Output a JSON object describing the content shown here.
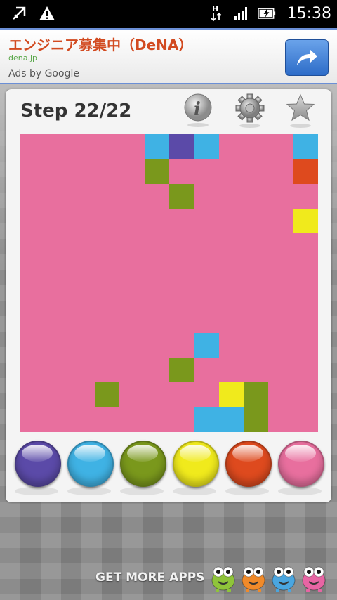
{
  "status_bar": {
    "time": "15:38",
    "icons": [
      "usb-debug-icon",
      "warning-icon",
      "data-transfer-icon",
      "signal-icon",
      "battery-charging-icon"
    ]
  },
  "ad": {
    "title": "エンジニア募集中（DeNA）",
    "url": "dena.jp",
    "attribution": "Ads by Google",
    "button_icon": "share-arrow-icon"
  },
  "game": {
    "step_label": "Step 22/22",
    "toolbar": [
      "info-icon",
      "gear-icon",
      "star-icon"
    ],
    "board_rows": [
      [
        "p",
        "p",
        "p",
        "p",
        "p",
        "b",
        "v",
        "b",
        "p",
        "p",
        "p",
        "b"
      ],
      [
        "p",
        "p",
        "p",
        "p",
        "p",
        "g",
        "p",
        "p",
        "p",
        "p",
        "p",
        "r"
      ],
      [
        "p",
        "p",
        "p",
        "p",
        "p",
        "p",
        "g",
        "p",
        "p",
        "p",
        "p",
        "p"
      ],
      [
        "p",
        "p",
        "p",
        "p",
        "p",
        "p",
        "p",
        "p",
        "p",
        "p",
        "p",
        "y"
      ],
      [
        "p",
        "p",
        "p",
        "p",
        "p",
        "p",
        "p",
        "p",
        "p",
        "p",
        "p",
        "p"
      ],
      [
        "p",
        "p",
        "p",
        "p",
        "p",
        "p",
        "p",
        "p",
        "p",
        "p",
        "p",
        "p"
      ],
      [
        "p",
        "p",
        "p",
        "p",
        "p",
        "p",
        "p",
        "p",
        "p",
        "p",
        "p",
        "p"
      ],
      [
        "p",
        "p",
        "p",
        "p",
        "p",
        "p",
        "p",
        "p",
        "p",
        "p",
        "p",
        "p"
      ],
      [
        "p",
        "p",
        "p",
        "p",
        "p",
        "p",
        "p",
        "b",
        "p",
        "p",
        "p",
        "p"
      ],
      [
        "p",
        "p",
        "p",
        "p",
        "p",
        "p",
        "g",
        "p",
        "p",
        "p",
        "p",
        "p"
      ],
      [
        "p",
        "p",
        "p",
        "g",
        "p",
        "p",
        "p",
        "p",
        "y",
        "g",
        "p",
        "p"
      ],
      [
        "p",
        "p",
        "p",
        "p",
        "p",
        "p",
        "p",
        "b",
        "b",
        "g",
        "p",
        "p"
      ]
    ],
    "palette": {
      "p": "#e86f9e",
      "b": "#3fb2e4",
      "v": "#5b4aa8",
      "g": "#7a981c",
      "r": "#de4a1e",
      "y": "#f0ea1c"
    },
    "color_buttons": [
      {
        "name": "purple",
        "color": "#5b4aa8"
      },
      {
        "name": "blue",
        "color": "#3fb2e4"
      },
      {
        "name": "green",
        "color": "#7a981c"
      },
      {
        "name": "yellow",
        "color": "#f0ea1c"
      },
      {
        "name": "red",
        "color": "#de4a1e"
      },
      {
        "name": "pink",
        "color": "#e86f9e"
      }
    ]
  },
  "footer": {
    "get_more_label": "GET MORE APPS",
    "mascots": [
      {
        "color": "#8fc43a"
      },
      {
        "color": "#f08a2a"
      },
      {
        "color": "#4aa6e0"
      },
      {
        "color": "#e865a4"
      }
    ]
  }
}
